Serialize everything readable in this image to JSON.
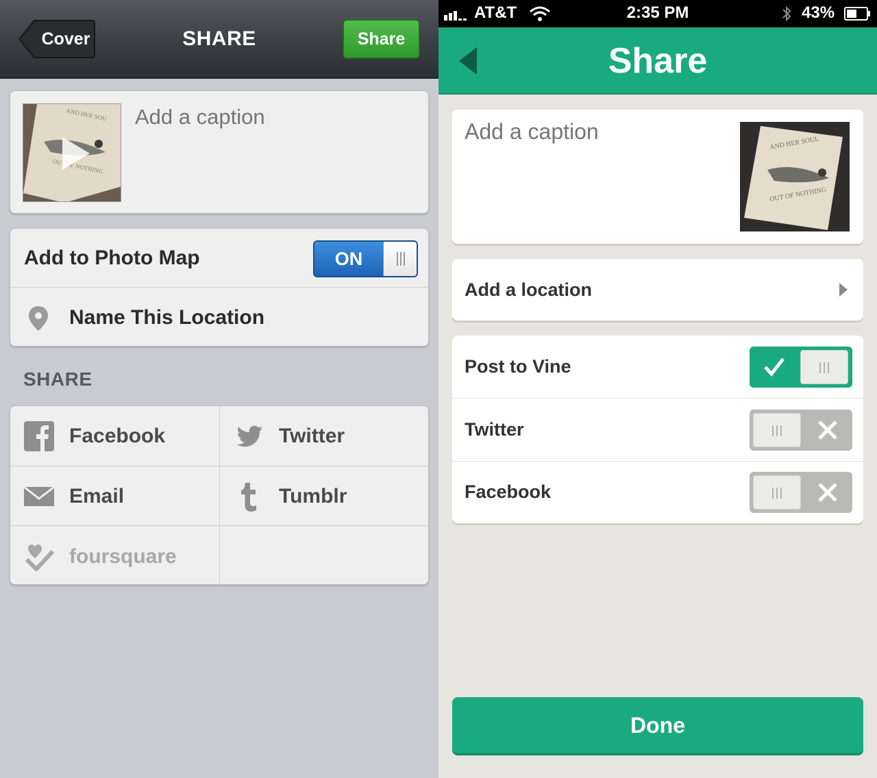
{
  "left": {
    "nav": {
      "back_label": "Cover",
      "title": "SHARE",
      "share_label": "Share"
    },
    "caption": {
      "placeholder": "Add a caption",
      "value": ""
    },
    "photo_map": {
      "label": "Add to Photo Map",
      "toggle_label": "ON",
      "enabled": true
    },
    "location": {
      "label": "Name This Location",
      "icon": "map-pin-icon"
    },
    "share_section": {
      "title": "SHARE",
      "services": [
        {
          "label": "Facebook",
          "icon": "facebook-icon",
          "enabled": true
        },
        {
          "label": "Twitter",
          "icon": "twitter-icon",
          "enabled": true
        },
        {
          "label": "Email",
          "icon": "email-icon",
          "enabled": true
        },
        {
          "label": "Tumblr",
          "icon": "tumblr-icon",
          "enabled": true
        },
        {
          "label": "foursquare",
          "icon": "foursquare-icon",
          "enabled": false
        }
      ]
    },
    "colors": {
      "share_button": "#3aa836",
      "toggle_on": "#2a78cf",
      "background": "#c9cbd0"
    }
  },
  "right": {
    "status_bar": {
      "carrier": "AT&T",
      "time": "2:35 PM",
      "battery": "43%"
    },
    "nav": {
      "title": "Share"
    },
    "caption": {
      "placeholder": "Add a caption",
      "value": ""
    },
    "location": {
      "label": "Add a location"
    },
    "toggles": [
      {
        "label": "Post to Vine",
        "on": true
      },
      {
        "label": "Twitter",
        "on": false
      },
      {
        "label": "Facebook",
        "on": false
      }
    ],
    "done_label": "Done",
    "colors": {
      "accent": "#1aaa7f",
      "background": "#e6e5e0"
    }
  }
}
